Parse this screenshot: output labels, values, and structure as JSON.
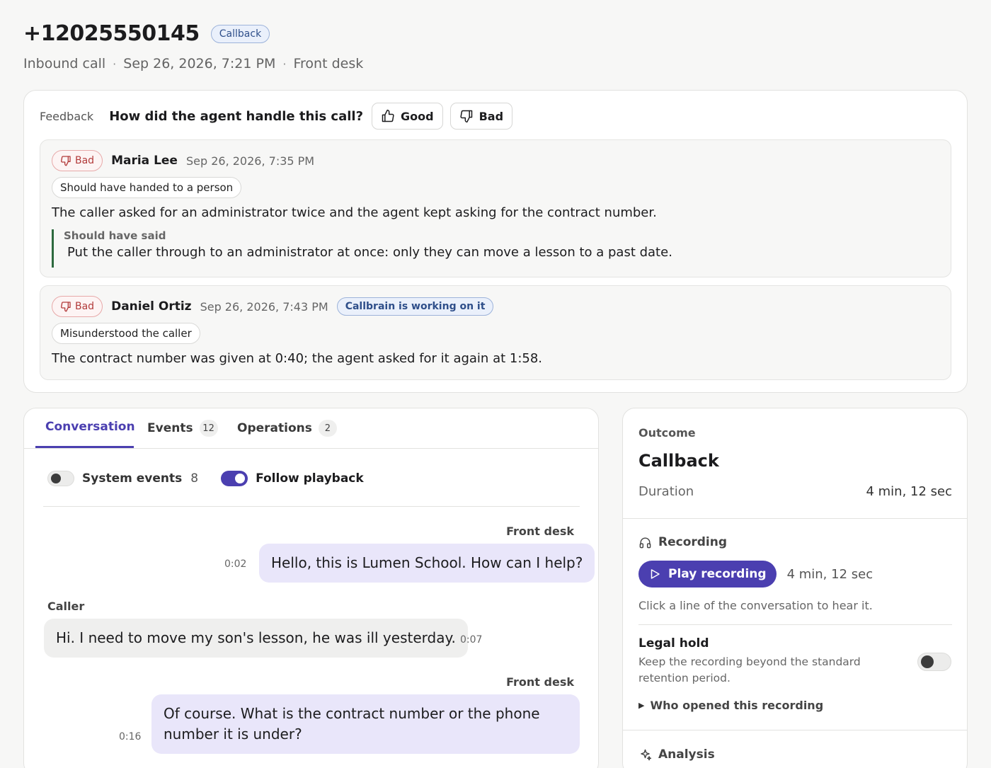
{
  "call": {
    "phone": "+12025550145",
    "badge": "Callback",
    "direction": "Inbound call",
    "datetime": "Sep 26, 2026, 7:21 PM",
    "line": "Front desk",
    "separator": "·"
  },
  "feedback": {
    "label": "Feedback",
    "question": "How did the agent handle this call?",
    "good_label": "Good",
    "bad_label": "Bad",
    "entries": [
      {
        "rating": "Bad",
        "author": "Maria Lee",
        "timestamp": "Sep 26, 2026, 7:35 PM",
        "reason": "Should have handed to a person",
        "comment": "The caller asked for an administrator twice and the agent kept asking for the contract number.",
        "should_have_said_label": "Should have said",
        "should_have_said": "Put the caller through to an administrator at once: only they can move a lesson to a past date."
      },
      {
        "rating": "Bad",
        "author": "Daniel Ortiz",
        "timestamp": "Sep 26, 2026, 7:43 PM",
        "status": "Callbrain is working on it",
        "reason": "Misunderstood the caller",
        "comment": "The contract number was given at 0:40; the agent asked for it again at 1:58."
      }
    ]
  },
  "tabs": [
    {
      "label": "Conversation",
      "count": ""
    },
    {
      "label": "Events",
      "count": "12"
    },
    {
      "label": "Operations",
      "count": "2"
    }
  ],
  "toggles": {
    "system_events_label": "System events",
    "system_events_count": "8",
    "system_events_on": false,
    "follow_playback_label": "Follow playback",
    "follow_playback_on": true
  },
  "messages": [
    {
      "speaker": "Front desk",
      "role": "agent",
      "time": "0:02",
      "text": "Hello, this is Lumen School. How can I help?"
    },
    {
      "speaker": "Caller",
      "role": "caller",
      "time": "0:07",
      "text": "Hi. I need to move my son's lesson, he was ill yesterday."
    },
    {
      "speaker": "Front desk",
      "role": "agent",
      "time": "0:16",
      "text": "Of course. What is the contract number or the phone number it is under?"
    }
  ],
  "outcome": {
    "label": "Outcome",
    "value": "Callback",
    "duration_label": "Duration",
    "duration_value": "4 min, 12 sec"
  },
  "recording": {
    "label": "Recording",
    "play_label": "Play recording",
    "duration": "4 min, 12 sec",
    "hint": "Click a line of the conversation to hear it.",
    "legal_hold_title": "Legal hold",
    "legal_hold_desc": "Keep the recording beyond the standard retention period.",
    "legal_hold_on": false,
    "who_opened": "Who opened this recording"
  },
  "analysis": {
    "label": "Analysis"
  },
  "colors": {
    "accent": "#4b3fb0",
    "bad": "#b23a3a",
    "info": "#2f4f8a",
    "quote_bar": "#2d6a3f"
  }
}
